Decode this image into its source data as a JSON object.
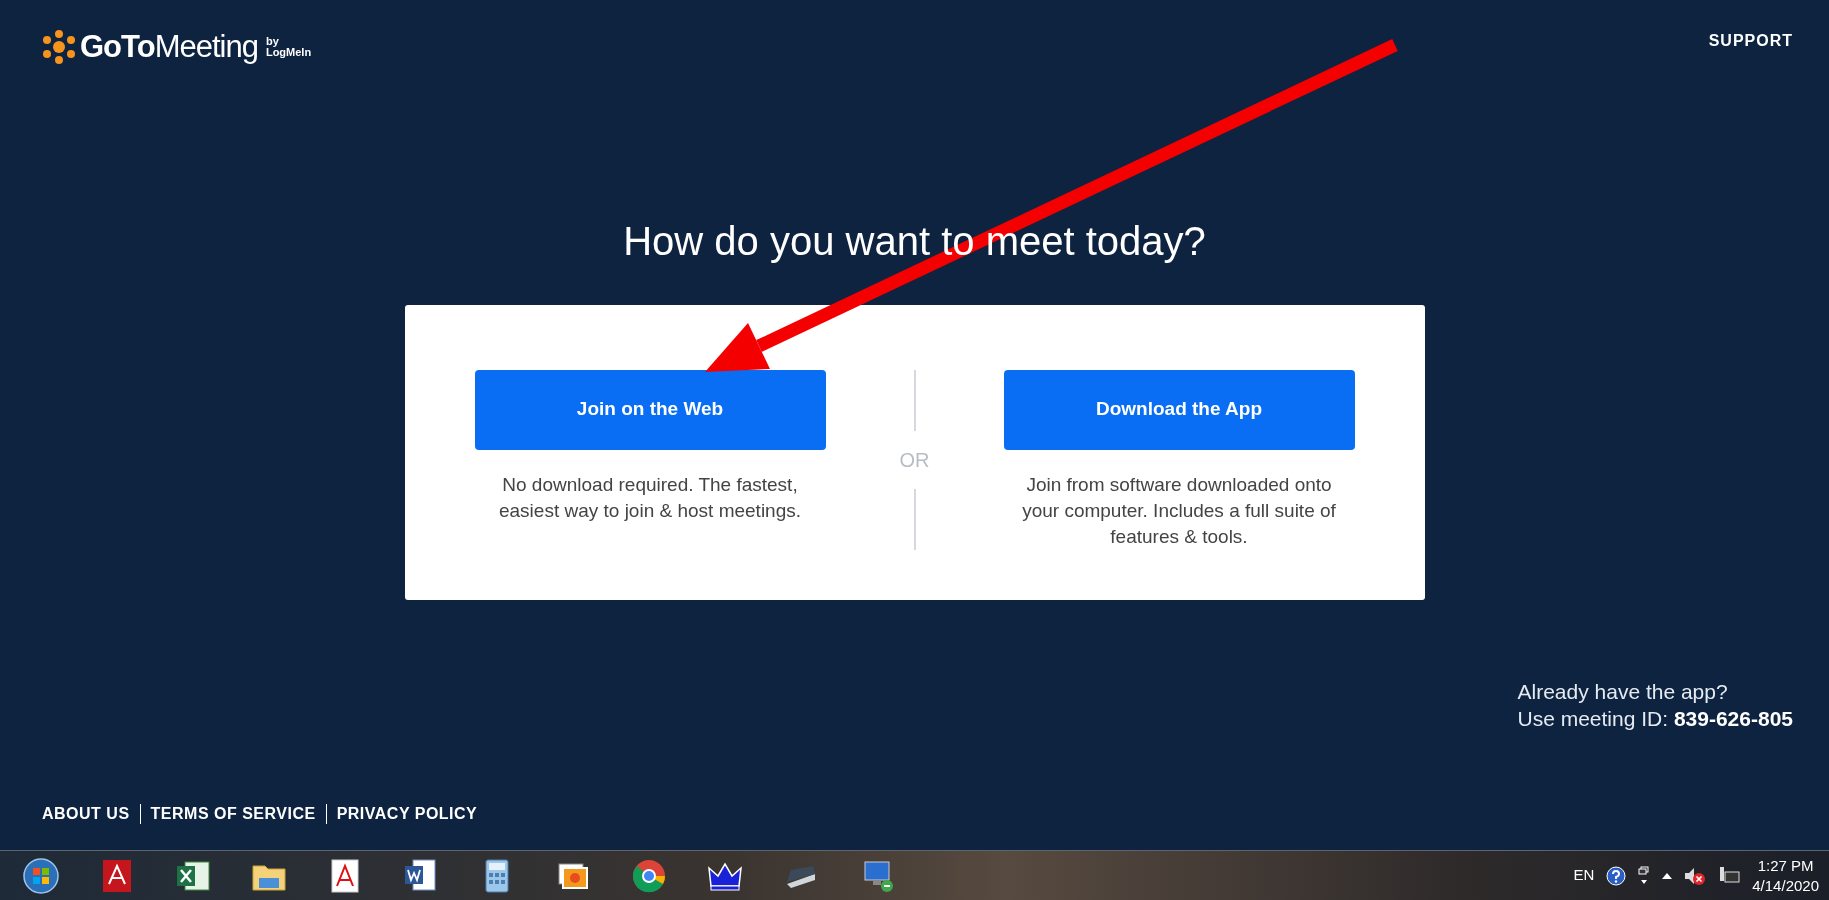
{
  "header": {
    "logo": {
      "bold": "GoTo",
      "light": "Meeting",
      "by": "by",
      "company": "LogMeIn"
    },
    "support_link": "SUPPORT"
  },
  "heading": "How do you want to meet today?",
  "options": [
    {
      "button": "Join on the Web",
      "description": "No download required. The fastest, easiest way to join & host meetings."
    },
    {
      "button": "Download the App",
      "description": "Join from software downloaded onto your computer. Includes a full suite of features & tools."
    }
  ],
  "divider_label": "OR",
  "already": {
    "question": "Already have the app?",
    "meeting_id": "Use meeting ID: **839-626-805**"
  },
  "footer_links": [
    "ABOUT US",
    "TERMS OF SERVICE",
    "PRIVACY POLICY"
  ],
  "taskbar": {
    "language": "EN",
    "time": "1:27 PM",
    "date": "4/14/2020"
  }
}
